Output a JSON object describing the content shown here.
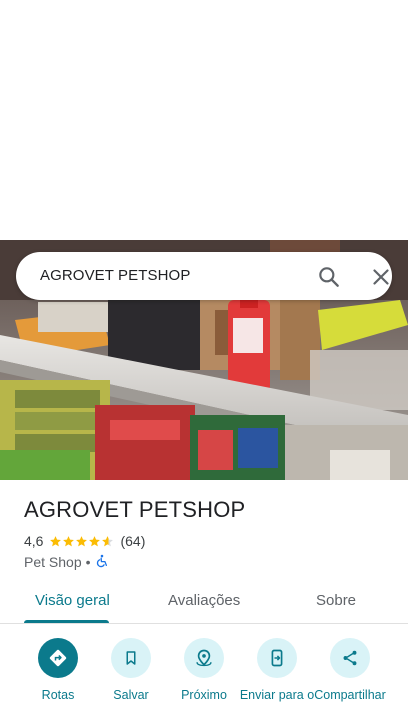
{
  "search": {
    "query": "AGROVET PETSHOP"
  },
  "place": {
    "title": "AGROVET PETSHOP",
    "rating": "4,6",
    "review_count": "(64)",
    "stars": 4.6,
    "category": "Pet Shop",
    "separator": "•",
    "accessibility_icon": "wheelchair-icon"
  },
  "tabs": [
    {
      "label": "Visão geral",
      "active": true
    },
    {
      "label": "Avaliações",
      "active": false
    },
    {
      "label": "Sobre",
      "active": false
    }
  ],
  "actions": [
    {
      "label": "Rotas",
      "icon": "directions-icon"
    },
    {
      "label": "Salvar",
      "icon": "bookmark-icon"
    },
    {
      "label": "Próximo",
      "icon": "nearby-icon"
    },
    {
      "label": "Enviar para o",
      "icon": "send-to-phone-icon"
    },
    {
      "label": "Compartilhar",
      "icon": "share-icon"
    }
  ],
  "colors": {
    "accent": "#0b7a8c",
    "accent_light": "#d9f3f7",
    "star": "#fbbc04",
    "accessibility": "#1a73e8"
  }
}
